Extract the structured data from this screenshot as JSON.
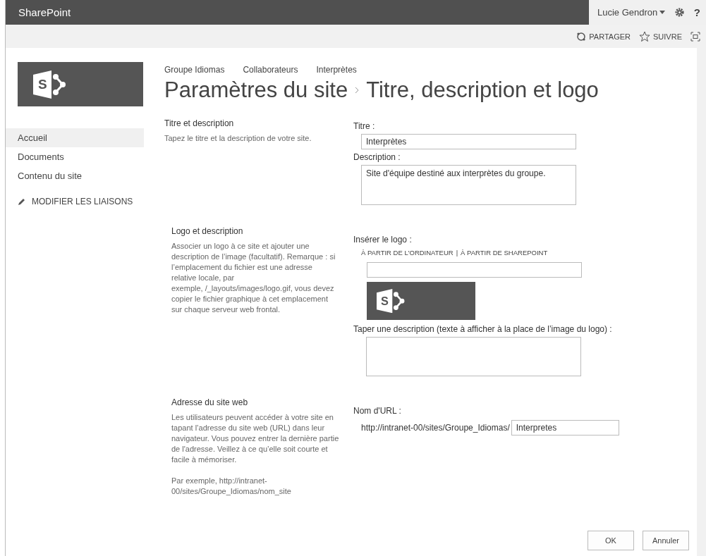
{
  "suite_bar": {
    "brand": "SharePoint",
    "user": "Lucie Gendron",
    "help": "?"
  },
  "actions": [
    {
      "kind": "share",
      "label": "PARTAGER"
    },
    {
      "kind": "follow",
      "label": "SUIVRE"
    },
    {
      "kind": "focus"
    }
  ],
  "site_logo": {
    "letter": "S"
  },
  "breadcrumb": [
    "Groupe Idiomas",
    "Collaborateurs",
    "Interprètes"
  ],
  "page_title": {
    "parent": "Paramètres du site",
    "current": "Titre, description et logo"
  },
  "nav": {
    "items": [
      {
        "label": "Accueil",
        "selected": true
      },
      {
        "label": "Documents",
        "selected": false
      },
      {
        "label": "Contenu du site",
        "selected": false
      }
    ],
    "edit_links": "MODIFIER LES LIAISONS"
  },
  "sections": [
    {
      "kind": "title",
      "heading": "Titre et description",
      "description": "Tapez le titre et la description de votre site.",
      "title_label": "Titre :",
      "title_value": "Interprètes",
      "description_label": "Description :",
      "description_value": "Site d'équipe destiné aux interprètes du groupe."
    },
    {
      "kind": "logo",
      "heading": "Logo et description",
      "description": "Associer un logo à ce site et ajouter une description de l’image (facultatif). Remarque : si l’emplacement du fichier est une adresse relative locale, par\nexemple, /_layouts/images/logo.gif, vous devez copier le fichier graphique à cet emplacement sur chaque serveur web frontal.",
      "insert_label": "Insérer le logo :",
      "sources": [
        "À PARTIR DE L'ORDINATEUR",
        "À PARTIR DE SHAREPOINT"
      ],
      "separator": "|",
      "preview": {
        "letter": "S"
      },
      "alt_label": "Taper une description (texte à afficher à la place de l’image du logo) :"
    },
    {
      "kind": "url",
      "heading": "Adresse du site web",
      "description": "Les utilisateurs peuvent accéder à votre site en tapant l’adresse du site web (URL) dans leur navigateur. Vous pouvez entrer la dernière partie de l'adresse. Veillez à ce qu’elle soit courte et facile à mémoriser.",
      "example": "Par exemple, http://intranet-00/sites/Groupe_Idiomas/nom_site",
      "url_label": "Nom d'URL :",
      "url_prefix": "http://intranet-00/sites/Groupe_Idiomas/",
      "url_value": "Interpretes"
    }
  ],
  "buttons": [
    "OK",
    "Annuler"
  ]
}
